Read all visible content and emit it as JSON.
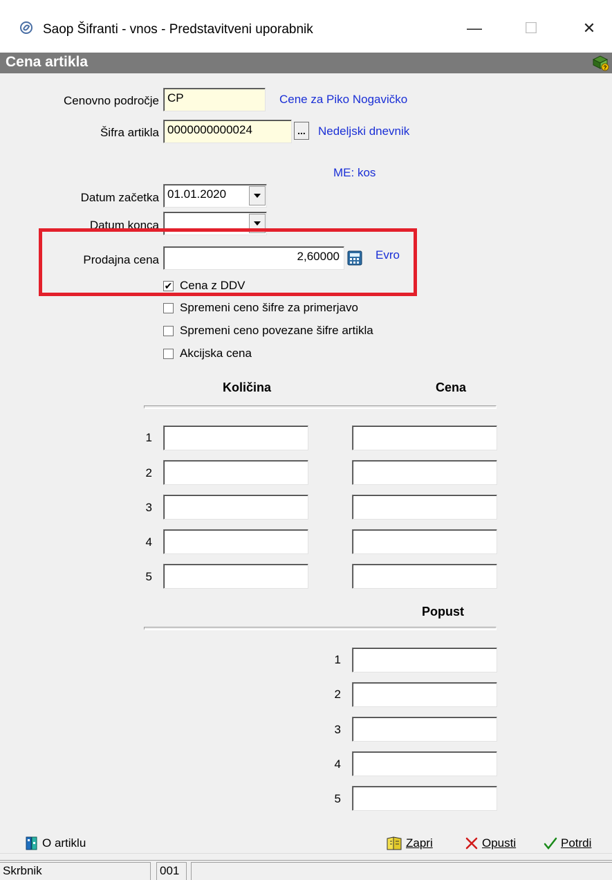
{
  "window": {
    "title": "Saop Šifranti - vnos - Predstavitveni uporabnik",
    "minimize": "—",
    "maximize": "☐",
    "close": "✕"
  },
  "header": {
    "title": "Cena artikla",
    "icon": "help-book-icon"
  },
  "form": {
    "price_area_label": "Cenovno področje",
    "price_area_value": "CP",
    "price_area_desc": "Cene za Piko Nogavičko",
    "article_code_label": "Šifra artikla",
    "article_code_value": "0000000000024",
    "article_code_browse": "...",
    "article_desc": "Nedeljski dnevnik",
    "unit": "ME: kos",
    "start_date_label": "Datum začetka",
    "start_date_value": "01.01.2020",
    "end_date_label": "Datum konca",
    "end_date_value": "",
    "sale_price_label": "Prodajna cena",
    "sale_price_value": "2,60000",
    "currency": "Evro"
  },
  "checkboxes": [
    {
      "label": "Cena z DDV",
      "checked": true
    },
    {
      "label": "Spremeni ceno šifre za primerjavo",
      "checked": false
    },
    {
      "label": "Spremeni ceno povezane šifre artikla",
      "checked": false
    },
    {
      "label": "Akcijska cena",
      "checked": false
    }
  ],
  "grid": {
    "qty_header": "Količina",
    "price_header": "Cena",
    "rows": [
      "1",
      "2",
      "3",
      "4",
      "5"
    ]
  },
  "discount": {
    "header": "Popust",
    "rows": [
      "1",
      "2",
      "3",
      "4",
      "5"
    ]
  },
  "toolbar": {
    "about_label": "O artiklu",
    "close_label": "Zapri",
    "cancel_label": "Opusti",
    "confirm_label": "Potrdi"
  },
  "status": {
    "user": "Skrbnik",
    "code": "001"
  },
  "colors": {
    "highlight_box": "#e3202b",
    "link_blue": "#1a2fd6",
    "header_band": "#7a7a7a",
    "field_yellow": "#fffde0"
  }
}
